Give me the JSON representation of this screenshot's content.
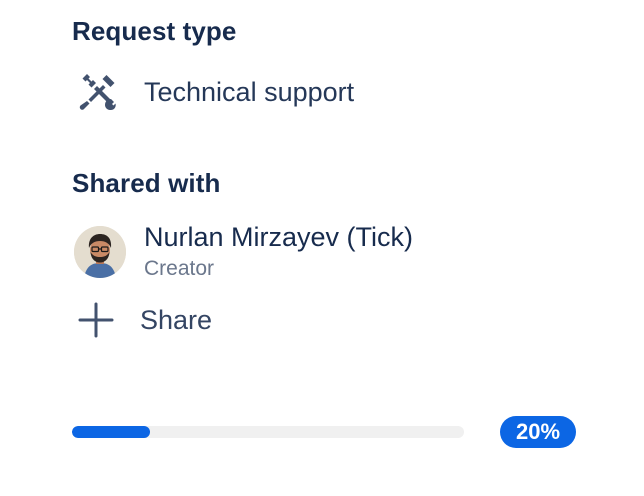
{
  "request_type": {
    "heading": "Request type",
    "icon": "tools-icon",
    "value": "Technical support"
  },
  "shared_with": {
    "heading": "Shared with",
    "person": {
      "name": "Nurlan Mirzayev (Tick)",
      "role": "Creator",
      "avatar": "avatar-illustration"
    },
    "share_action": {
      "icon": "plus-icon",
      "label": "Share"
    }
  },
  "progress": {
    "fraction": 0.2,
    "label": "20%"
  },
  "colors": {
    "text_primary": "#172b4d",
    "text_secondary": "#6b778c",
    "accent": "#0c66e4",
    "track": "#f0f0f0"
  }
}
